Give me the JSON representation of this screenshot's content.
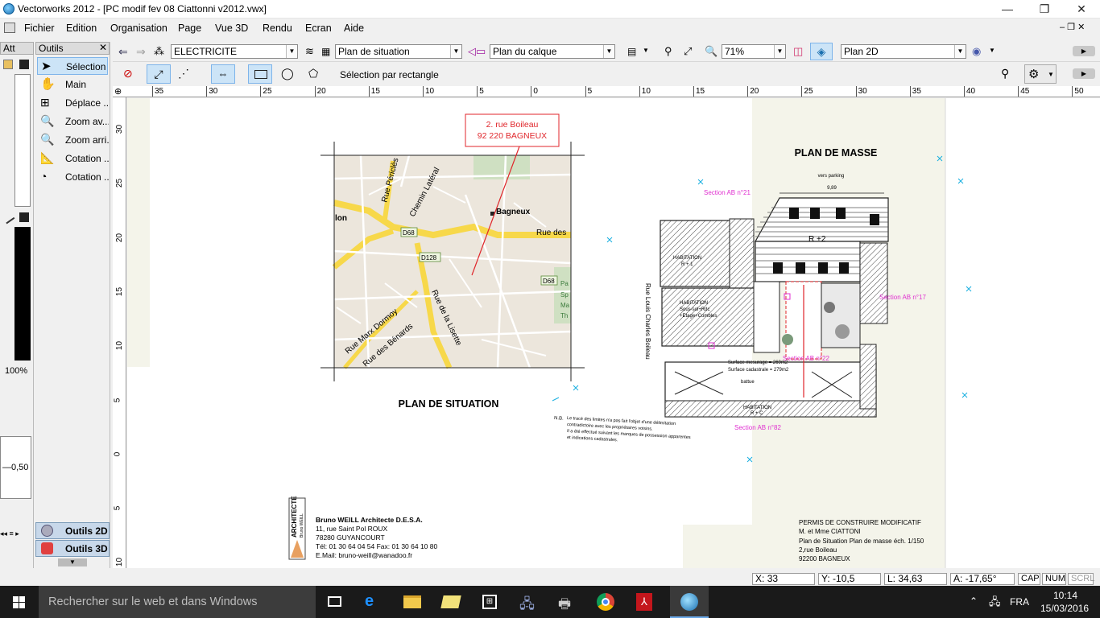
{
  "window": {
    "title": "Vectorworks 2012 - [PC modif fev 08 Ciattonni v2012.vwx]",
    "minimize": "—",
    "maximize": "❐",
    "close": "✕"
  },
  "menu": [
    "Fichier",
    "Edition",
    "Organisation",
    "Page",
    "Vue 3D",
    "Rendu",
    "Ecran",
    "Aide"
  ],
  "attributes_palette": {
    "title": "Att",
    "zoom": "100%",
    "line_weight": "0,50"
  },
  "tools_palette": {
    "title": "Outils",
    "items": [
      "Sélection",
      "Main",
      "Déplace ...",
      "Zoom av...",
      "Zoom arri...",
      "Cotation ...",
      "Cotation ..."
    ],
    "sets": [
      "Outils 2D",
      "Outils 3D"
    ]
  },
  "view_bar": {
    "class": "ELECTRICITE",
    "layer": "Plan de situation",
    "layer_options": "Plan du calque",
    "zoom": "71%",
    "view": "Plan 2D"
  },
  "mode_bar": {
    "mode_label": "Sélection par rectangle"
  },
  "rulers": {
    "horizontal": [
      "35",
      "30",
      "25",
      "20",
      "15",
      "10",
      "5",
      "0",
      "5",
      "10",
      "15",
      "20",
      "25",
      "30",
      "35",
      "40",
      "45",
      "50"
    ],
    "vertical": [
      "30",
      "25",
      "20",
      "15",
      "10",
      "5",
      "0",
      "5",
      "10"
    ]
  },
  "drawing": {
    "address_label": [
      "2. rue Boileau",
      "92 220 BAGNEUX"
    ],
    "map_labels": {
      "bagneux": "Bagneux",
      "rue_pericles": "Rue Périclès",
      "chemin_latéral": "Chemin Latéral",
      "rue_des": "Rue des",
      "ion": "lon",
      "rue_max_dormoy": "Rue Marx Dormoy",
      "rue_de_la_lisette": "Rue de la Lisette",
      "rue_des_bonards": "Rue des Bénards",
      "d68a": "D68",
      "d128": "D128",
      "d68b": "D68",
      "pa": "Pa",
      "sp": "Sp",
      "ma": "Ma",
      "th": "Th"
    },
    "plan_situation_title": "PLAN DE SITUATION",
    "plan_masse_title": "PLAN DE MASSE",
    "vers_parking": "vers parking",
    "sections": [
      "Section AB n°21",
      "Section AB n°17",
      "Section AB n°22",
      "Section AB n°82"
    ],
    "rue_louis": "Rue Louis Charles Boileau",
    "habitation_r1": [
      "HABITATION",
      "R + 1"
    ],
    "habitation_r2": "R +2",
    "habitation_sous_sol": [
      "HABITATION",
      "Sous-sol+Rdc",
      "+Etage+Combles"
    ],
    "habitation_r_c": [
      "HABITATION",
      "R + C"
    ],
    "surface_mesurage": "Surface mesurage = 269m2",
    "surface_cadastrale": "Surface cadastrale = 279m2",
    "lieu_battue": "battue",
    "dim_989": "9,89",
    "note_title": "N.B.",
    "note_lines": [
      "Le tracé des limites n'a pas fait l'objet d'une délimitation",
      "contradictoire avec les propriétaires voisins.",
      "Il a été effectué suivant les marques de possession apparentes",
      "et indications cadastrales."
    ],
    "architect": {
      "logo_vertical": "ARCHITECTE",
      "logo_name": "Bruno WEILL",
      "name": "Bruno WEILL Architecte D.E.S.A.",
      "address": "11, rue Saint Pol ROUX",
      "city": "78280 GUYANCOURT",
      "tel": "Tél: 01 30 64 04 54 Fax: 01 30 64 10 80",
      "email": "E.Mail: bruno-weill@wanadoo.fr"
    },
    "permit": [
      "PERMIS DE CONSTRUIRE MODIFICATIF",
      "M. et Mme CIATTONI",
      "Plan de Situation Plan de masse éch. 1/150",
      "2,rue Boileau",
      "92200 BAGNEUX"
    ]
  },
  "status": {
    "x_label": "X:",
    "x": "33",
    "y_label": "Y:",
    "y": "-10,5",
    "l_label": "L:",
    "l": "34,63",
    "a_label": "A:",
    "a": "-17,65°",
    "caps": "CAP",
    "num": "NUM",
    "scrl": "SCRL"
  },
  "taskbar": {
    "search_placeholder": "Rechercher sur le web et dans Windows",
    "lang": "FRA",
    "time": "10:14",
    "date": "15/03/2016"
  },
  "colors": {
    "accent_red": "#e0262b",
    "magenta": "#e030d0",
    "cyan": "#1ab0e0",
    "map_road": "#f7d84a",
    "map_bg": "#ece6dc"
  }
}
